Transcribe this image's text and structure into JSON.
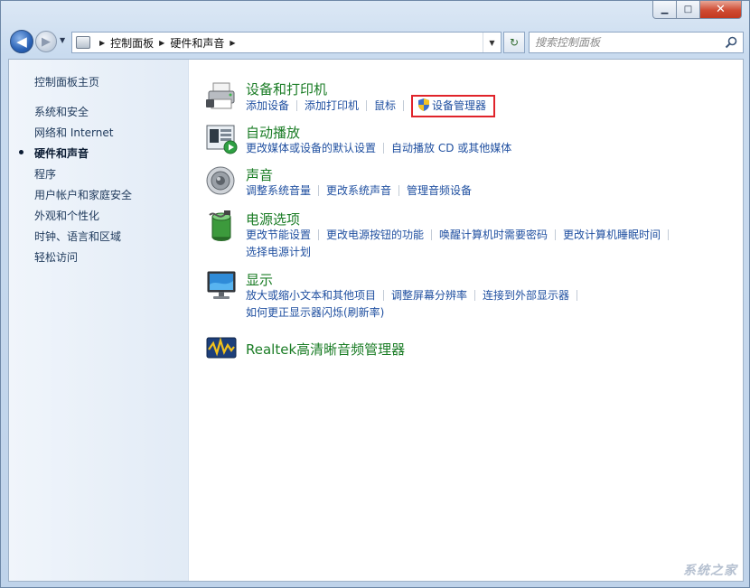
{
  "window": {
    "minimize_glyph": "▁",
    "maximize_glyph": "□",
    "close_glyph": "✕"
  },
  "nav": {
    "back_glyph": "◀",
    "forward_glyph": "▶",
    "history_glyph": "▼",
    "breadcrumb": [
      "控制面板",
      "硬件和声音"
    ],
    "crumb_separator": "▶",
    "address_dropdown_glyph": "▼",
    "refresh_glyph": "↻",
    "search_placeholder": "搜索控制面板"
  },
  "sidebar": {
    "items": [
      {
        "label": "控制面板主页",
        "current": false
      },
      {
        "label": "系统和安全",
        "current": false
      },
      {
        "label": "网络和 Internet",
        "current": false
      },
      {
        "label": "硬件和声音",
        "current": true
      },
      {
        "label": "程序",
        "current": false
      },
      {
        "label": "用户帐户和家庭安全",
        "current": false
      },
      {
        "label": "外观和个性化",
        "current": false
      },
      {
        "label": "时钟、语言和区域",
        "current": false
      },
      {
        "label": "轻松访问",
        "current": false
      }
    ]
  },
  "categories": [
    {
      "title": "设备和打印机",
      "icon": "printer-icon",
      "links": [
        "添加设备",
        "添加打印机",
        "鼠标",
        "设备管理器"
      ]
    },
    {
      "title": "自动播放",
      "icon": "autoplay-icon",
      "links": [
        "更改媒体或设备的默认设置",
        "自动播放 CD 或其他媒体"
      ]
    },
    {
      "title": "声音",
      "icon": "speaker-icon",
      "links": [
        "调整系统音量",
        "更改系统声音",
        "管理音频设备"
      ]
    },
    {
      "title": "电源选项",
      "icon": "battery-icon",
      "links": [
        "更改节能设置",
        "更改电源按钮的功能",
        "唤醒计算机时需要密码",
        "更改计算机睡眠时间",
        "选择电源计划"
      ]
    },
    {
      "title": "显示",
      "icon": "monitor-icon",
      "links": [
        "放大或缩小文本和其他项目",
        "调整屏幕分辨率",
        "连接到外部显示器",
        "如何更正显示器闪烁(刷新率)"
      ]
    },
    {
      "title": "Realtek高清晰音频管理器",
      "icon": "realtek-audio-icon",
      "links": []
    }
  ],
  "colors": {
    "category_title": "#1a7c25",
    "task_link": "#1f4fa0",
    "highlight_border": "#e0232a"
  },
  "watermark": "系统之家"
}
